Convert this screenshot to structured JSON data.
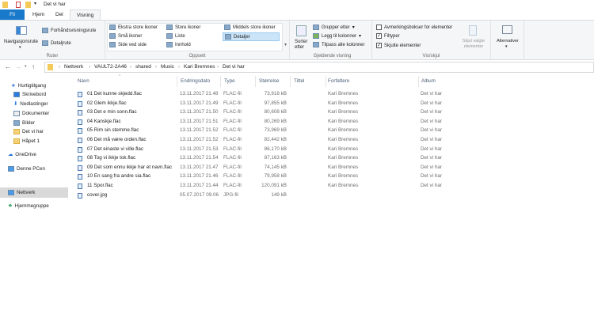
{
  "window": {
    "title": "Det vi har"
  },
  "tabs": [
    "Fil",
    "Hjem",
    "Del",
    "Visning"
  ],
  "ribbon": {
    "ruter": {
      "label": "Ruter",
      "nav": "Navigasjonsrute",
      "preview": "Forhåndsvisningsrute",
      "details": "Detaljrute"
    },
    "oppsett": {
      "label": "Oppsett",
      "items": [
        "Ekstra store ikoner",
        "Store ikoner",
        "Middels store ikoner",
        "Små ikoner",
        "Liste",
        "Detaljer",
        "Side ved side",
        "Innhold"
      ]
    },
    "gjeldende": {
      "label": "Gjeldende visning",
      "sort": "Sorter etter",
      "group": "Grupper etter",
      "add_cols": "Legg til kolonner",
      "fit_cols": "Tilpass alle kolonner"
    },
    "visskjul": {
      "label": "Vis/skjul",
      "checkboxes": [
        {
          "label": "Avmerkingsbokser for elementer",
          "checked": false
        },
        {
          "label": "Filtyper",
          "checked": true
        },
        {
          "label": "Skjulte elementer",
          "checked": true
        }
      ],
      "hide": "Skjul valgte elementer"
    },
    "alternativer": "Alternativer"
  },
  "breadcrumb": [
    "Nettverk",
    "VAULT2-2A46",
    "shared",
    "Music",
    "Kari Bremnes",
    "Det vi har"
  ],
  "sidebar": [
    "Hurtigtilgang",
    "Skrivebord",
    "Nedlastinger",
    "Dokumenter",
    "Bilder",
    "Det vi har",
    "Håpet 1",
    "OneDrive",
    "Denne PCen",
    "Nettverk",
    "Hjemmegruppe"
  ],
  "columns": [
    "Navn",
    "Endringsdato",
    "Type",
    "Størrelse",
    "Tittel",
    "Forfattere",
    "Album"
  ],
  "files": [
    [
      "01 Det kunne skjedd.flac",
      "13.11.2017 21.48",
      "FLAC-fil",
      "73,918 kB",
      "",
      "Kari Bremnes",
      "Det vi har"
    ],
    [
      "02 Glem ikkje.flac",
      "13.11.2017 21.49",
      "FLAC-fil",
      "97,855 kB",
      "",
      "Kari Bremnes",
      "Det vi har"
    ],
    [
      "03 Det e min sonn.flac",
      "13.11.2017 21.50",
      "FLAC-fil",
      "80,608 kB",
      "",
      "Kari Bremnes",
      "Det vi har"
    ],
    [
      "04 Kanskje.flac",
      "13.11.2017 21.51",
      "FLAC-fil",
      "80,269 kB",
      "",
      "Kari Bremnes",
      "Det vi har"
    ],
    [
      "05 Rim sin stemme.flac",
      "13.11.2017 21.52",
      "FLAC-fil",
      "73,969 kB",
      "",
      "Kari Bremnes",
      "Det vi har"
    ],
    [
      "06 Det må være orden.flac",
      "13.11.2017 21.52",
      "FLAC-fil",
      "82,442 kB",
      "",
      "Kari Bremnes",
      "Det vi har"
    ],
    [
      "07 Det einaste vi ville.flac",
      "13.11.2017 21.53",
      "FLAC-fil",
      "86,170 kB",
      "",
      "Kari Bremnes",
      "Det vi har"
    ],
    [
      "08 Tog vi ikkje tok.flac",
      "13.11.2017 21.54",
      "FLAC-fil",
      "87,163 kB",
      "",
      "Kari Bremnes",
      "Det vi har"
    ],
    [
      "09 Det som ennu ikkje har et navn.flac",
      "13.11.2017 21.47",
      "FLAC-fil",
      "74,145 kB",
      "",
      "Kari Bremnes",
      "Det vi har"
    ],
    [
      "10 En sang fra andre sia.flac",
      "13.11.2017 21.46",
      "FLAC-fil",
      "79,958 kB",
      "",
      "Kari Bremnes",
      "Det vi har"
    ],
    [
      "11 Spor.flac",
      "13.11.2017 21.44",
      "FLAC-fil",
      "120,091 kB",
      "",
      "Kari Bremnes",
      "Det vi har"
    ],
    [
      "cover.jpg",
      "05.07.2017 09.06",
      "JPG-fil",
      "149 kB",
      "",
      "",
      ""
    ]
  ]
}
